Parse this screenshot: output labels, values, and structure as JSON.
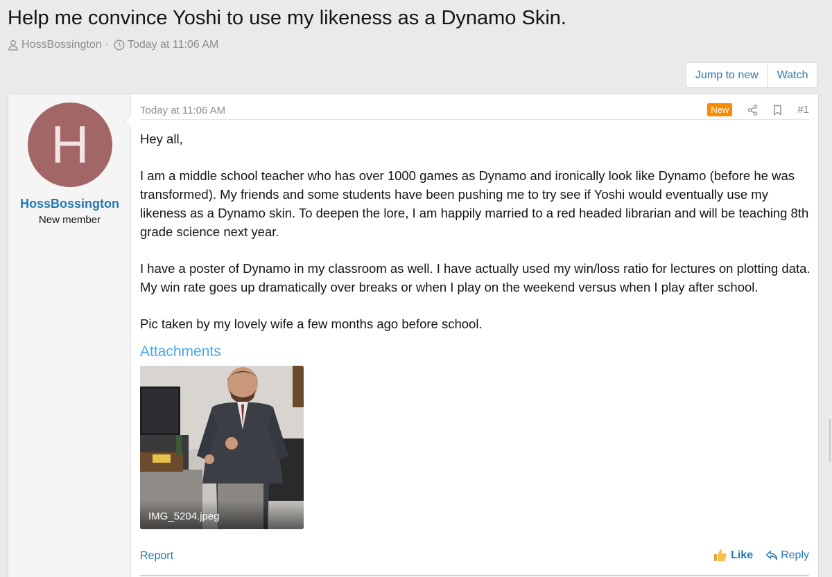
{
  "thread": {
    "title": "Help me convince Yoshi to use my likeness as a Dynamo Skin.",
    "author": "HossBossington",
    "date": "Today at 11:06 AM"
  },
  "actions": {
    "jump_to_new": "Jump to new",
    "watch": "Watch"
  },
  "post": {
    "avatar_letter": "H",
    "avatar_color": "#a36666",
    "username": "HossBossington",
    "user_title": "New member",
    "date": "Today at 11:06 AM",
    "badge": "New",
    "number": "#1",
    "paragraphs": [
      "Hey all,",
      "I am a middle school teacher who has over 1000 games as Dynamo and ironically look like Dynamo (before he was transformed). My friends and some students have been pushing me to try see if Yoshi would eventually use my likeness as a Dynamo skin. To deepen the lore, I am happily married to a red headed librarian and will be teaching 8th grade science next year.",
      "I have a poster of Dynamo in my classroom as well. I have actually used my win/loss ratio for lectures on plotting data. My win rate goes up dramatically over breaks or when I play on the weekend versus when I play after school.",
      "Pic taken by my lovely wife a few months ago before school."
    ],
    "attachments_title": "Attachments",
    "attachment_filename": "IMG_5204.jpeg",
    "report_label": "Report",
    "like_label": "Like",
    "reply_label": "Reply"
  },
  "colors": {
    "link": "#2577b1",
    "badge_new": "#f78c00",
    "attachments_heading": "#47a7eb"
  }
}
